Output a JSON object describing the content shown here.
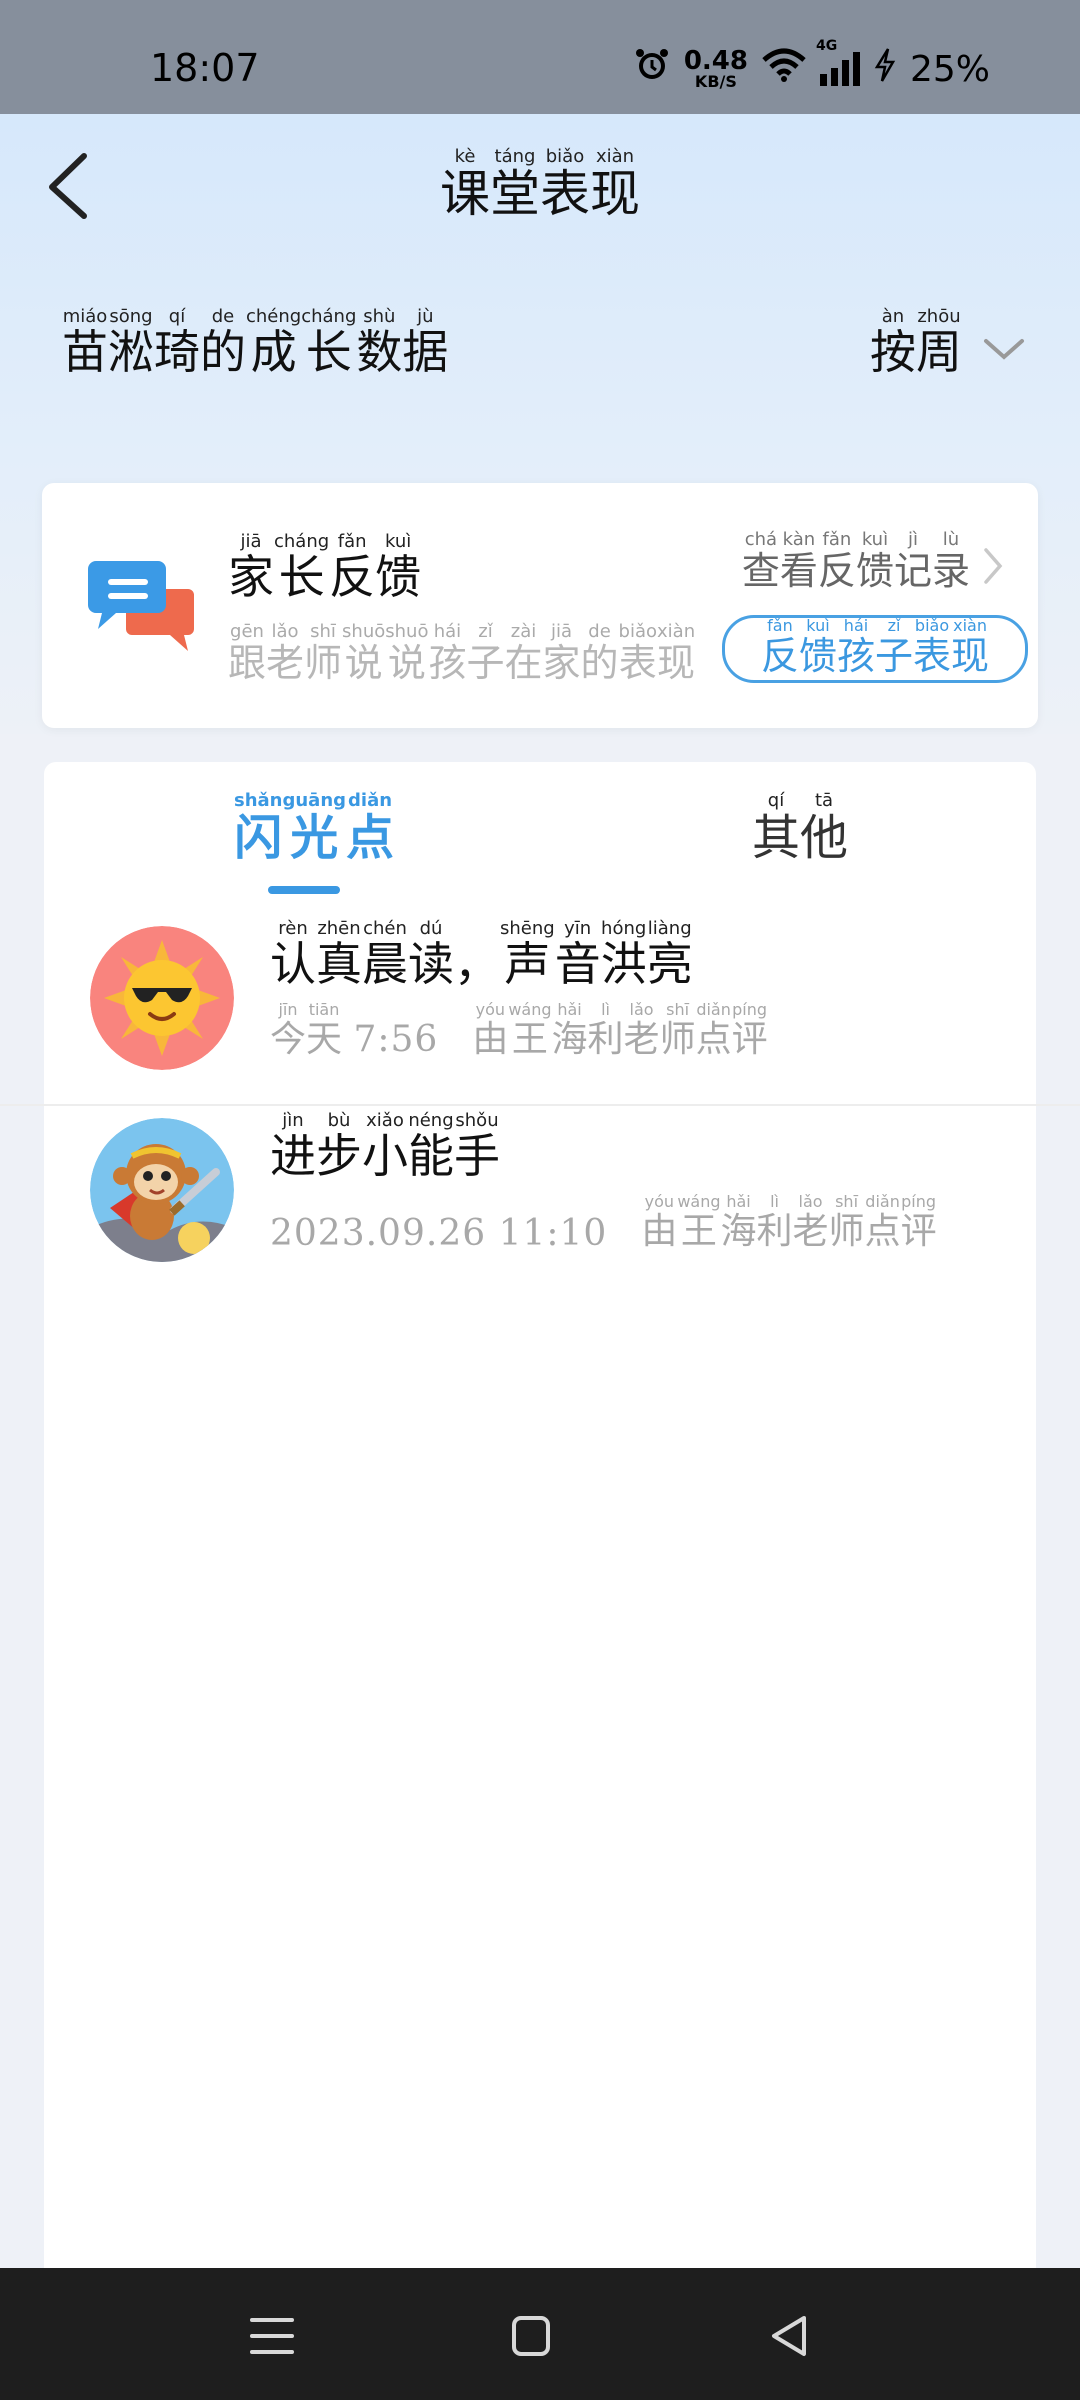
{
  "status_bar": {
    "time": "18:07",
    "net_speed_value": "0.48",
    "net_speed_unit": "KB/S",
    "network_type": "4G",
    "battery": "25%"
  },
  "header": {
    "title_chars": [
      "课",
      "堂",
      "表",
      "现"
    ],
    "title_pinyin": [
      "kè",
      "táng",
      "biǎo",
      "xiàn"
    ]
  },
  "growth": {
    "chars": [
      "苗",
      "淞",
      "琦",
      "的",
      "成",
      "长",
      "数",
      "据"
    ],
    "pinyin": [
      "miáo",
      "sōng",
      "qí",
      "de",
      "chéng",
      "cháng",
      "shù",
      "jù"
    ]
  },
  "period": {
    "chars": [
      "按",
      "周"
    ],
    "pinyin": [
      "àn",
      "zhōu"
    ]
  },
  "feedback_card": {
    "title_chars": [
      "家",
      "长",
      "反",
      "馈"
    ],
    "title_pinyin": [
      "jiā",
      "cháng",
      "fǎn",
      "kuì"
    ],
    "sub_chars": [
      "跟",
      "老",
      "师",
      "说",
      "说",
      "孩",
      "子",
      "在",
      "家",
      "的",
      "表",
      "现"
    ],
    "sub_pinyin": [
      "gēn",
      "lǎo",
      "shī",
      "shuō",
      "shuō",
      "hái",
      "zǐ",
      "zài",
      "jiā",
      "de",
      "biǎo",
      "xiàn"
    ],
    "records_chars": [
      "查",
      "看",
      "反",
      "馈",
      "记",
      "录"
    ],
    "records_pinyin": [
      "chá",
      "kàn",
      "fǎn",
      "kuì",
      "jì",
      "lù"
    ],
    "button_chars": [
      "反",
      "馈",
      "孩",
      "子",
      "表",
      "现"
    ],
    "button_pinyin": [
      "fǎn",
      "kuì",
      "hái",
      "zǐ",
      "biǎo",
      "xiàn"
    ]
  },
  "tabs": [
    {
      "chars": [
        "闪",
        "光",
        "点"
      ],
      "pinyin": [
        "shǎn",
        "guāng",
        "diǎn"
      ],
      "active": true
    },
    {
      "chars": [
        "其",
        "他"
      ],
      "pinyin": [
        "qí",
        "tā"
      ],
      "active": false
    }
  ],
  "items": [
    {
      "avatar": "sun-sunglasses",
      "title_chars": [
        "认",
        "真",
        "晨",
        "读",
        "，",
        "声",
        "音",
        "洪",
        "亮"
      ],
      "title_pinyin": [
        "rèn",
        "zhēn",
        "chén",
        "dú",
        "",
        "shēng",
        "yīn",
        "hóng",
        "liàng"
      ],
      "date_chars": [
        "今",
        "天"
      ],
      "date_pinyin": [
        "jīn",
        "tiān"
      ],
      "time": "7:56",
      "by_chars": [
        "由",
        "王",
        "海",
        "利",
        "老",
        "师",
        "点",
        "评"
      ],
      "by_pinyin": [
        "yóu",
        "wáng",
        "hǎi",
        "lì",
        "lǎo",
        "shī",
        "diǎn",
        "píng"
      ]
    },
    {
      "avatar": "monkey-king",
      "title_chars": [
        "进",
        "步",
        "小",
        "能",
        "手"
      ],
      "title_pinyin": [
        "jìn",
        "bù",
        "xiǎo",
        "néng",
        "shǒu"
      ],
      "date_chars": [],
      "date_pinyin": [],
      "time": "2023.09.26 11:10",
      "by_chars": [
        "由",
        "王",
        "海",
        "利",
        "老",
        "师",
        "点",
        "评"
      ],
      "by_pinyin": [
        "yóu",
        "wáng",
        "hǎi",
        "lì",
        "lǎo",
        "shī",
        "diǎn",
        "píng"
      ]
    }
  ],
  "colors": {
    "accent": "#3a98e2",
    "header_bg": "#d6e8fb",
    "nav_bg": "#1e1e1e",
    "status_bg": "#868f9c"
  },
  "nav_icons": [
    "menu-icon",
    "home-icon",
    "back-triangle-icon"
  ]
}
